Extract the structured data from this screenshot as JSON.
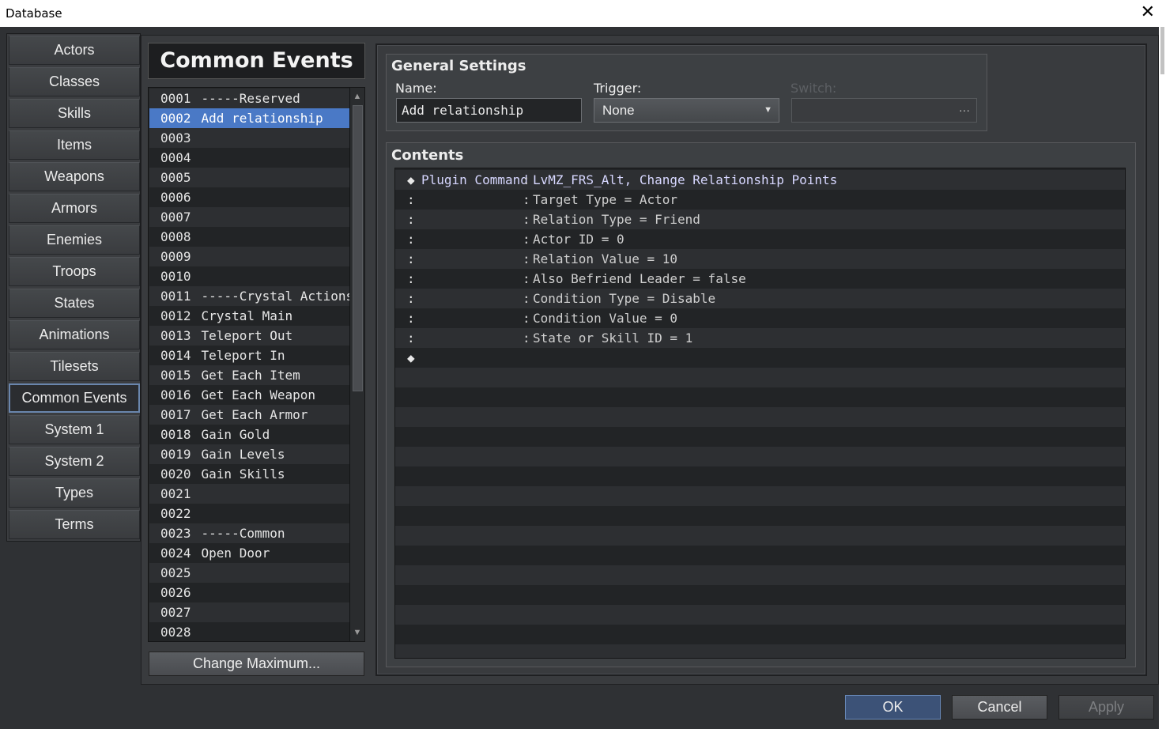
{
  "window": {
    "title": "Database",
    "close_glyph": "✕"
  },
  "tabs": [
    {
      "label": "Actors"
    },
    {
      "label": "Classes"
    },
    {
      "label": "Skills"
    },
    {
      "label": "Items"
    },
    {
      "label": "Weapons"
    },
    {
      "label": "Armors"
    },
    {
      "label": "Enemies"
    },
    {
      "label": "Troops"
    },
    {
      "label": "States"
    },
    {
      "label": "Animations"
    },
    {
      "label": "Tilesets"
    },
    {
      "label": "Common Events",
      "active": true
    },
    {
      "label": "System 1"
    },
    {
      "label": "System 2"
    },
    {
      "label": "Types"
    },
    {
      "label": "Terms"
    }
  ],
  "list": {
    "title": "Common Events",
    "selected_index": 1,
    "items": [
      {
        "id": "0001",
        "name": "-----Reserved"
      },
      {
        "id": "0002",
        "name": "Add relationship"
      },
      {
        "id": "0003",
        "name": ""
      },
      {
        "id": "0004",
        "name": ""
      },
      {
        "id": "0005",
        "name": ""
      },
      {
        "id": "0006",
        "name": ""
      },
      {
        "id": "0007",
        "name": ""
      },
      {
        "id": "0008",
        "name": ""
      },
      {
        "id": "0009",
        "name": ""
      },
      {
        "id": "0010",
        "name": ""
      },
      {
        "id": "0011",
        "name": "-----Crystal Actions"
      },
      {
        "id": "0012",
        "name": "Crystal Main"
      },
      {
        "id": "0013",
        "name": "Teleport Out"
      },
      {
        "id": "0014",
        "name": "Teleport In"
      },
      {
        "id": "0015",
        "name": "Get Each Item"
      },
      {
        "id": "0016",
        "name": "Get Each Weapon"
      },
      {
        "id": "0017",
        "name": "Get Each Armor"
      },
      {
        "id": "0018",
        "name": "Gain Gold"
      },
      {
        "id": "0019",
        "name": "Gain Levels"
      },
      {
        "id": "0020",
        "name": "Gain Skills"
      },
      {
        "id": "0021",
        "name": ""
      },
      {
        "id": "0022",
        "name": ""
      },
      {
        "id": "0023",
        "name": "-----Common"
      },
      {
        "id": "0024",
        "name": "Open Door"
      },
      {
        "id": "0025",
        "name": ""
      },
      {
        "id": "0026",
        "name": ""
      },
      {
        "id": "0027",
        "name": ""
      },
      {
        "id": "0028",
        "name": ""
      }
    ],
    "scroll_up": "▲",
    "scroll_down": "▼",
    "change_max_label": "Change Maximum..."
  },
  "general": {
    "title": "General Settings",
    "name_label": "Name:",
    "name_value": "Add relationship",
    "trigger_label": "Trigger:",
    "trigger_value": "None",
    "trigger_arrow": "▼",
    "switch_label": "Switch:",
    "switch_value": "",
    "switch_button": "···"
  },
  "contents": {
    "title": "Contents",
    "command": {
      "bullet": "◆",
      "name": "Plugin Command",
      "separator": ":",
      "args": "LvMZ_FRS_Alt, Change Relationship Points"
    },
    "params": [
      "Target Type = Actor",
      "Relation Type = Friend",
      "Actor ID = 0",
      "Relation Value = 10",
      "Also Befriend Leader = false",
      "Condition Type = Disable",
      "Condition Value = 0",
      "State or Skill ID = 1"
    ],
    "continuation": ":",
    "end_bullet": "◆"
  },
  "footer": {
    "ok": "OK",
    "cancel": "Cancel",
    "apply": "Apply"
  },
  "colors": {
    "selection": "#4a79c6",
    "accent_border": "#6a86ad",
    "background": "#2f3134"
  }
}
